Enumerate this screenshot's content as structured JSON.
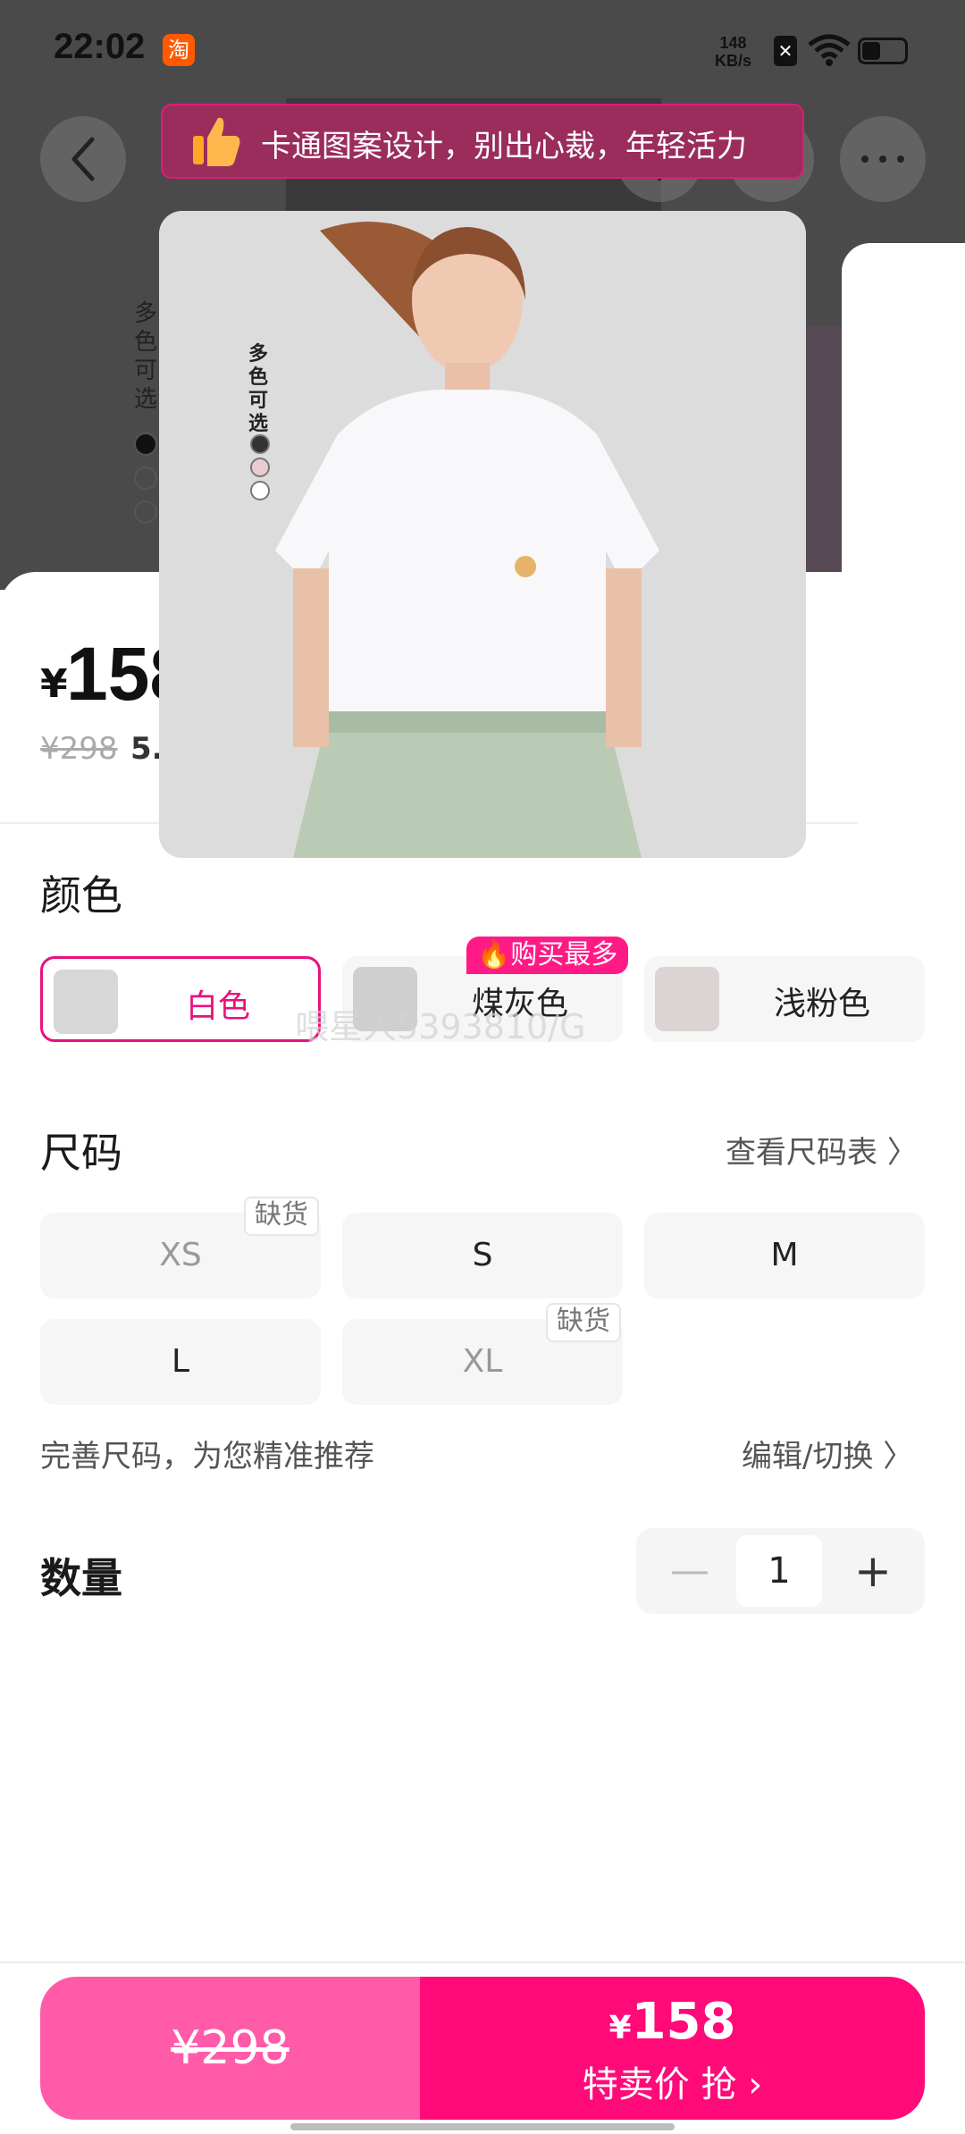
{
  "status_bar": {
    "time": "22:02",
    "app_badge": "淘",
    "net_speed_value": "148",
    "net_speed_unit": "KB/s"
  },
  "tooltip": {
    "text": "卡通图案设计，别出心裁，年轻活力"
  },
  "background_page": {
    "side_text": "多色可选"
  },
  "product_card": {
    "side_text": "多色可选"
  },
  "price": {
    "symbol": "¥",
    "value": "158",
    "original": "¥298",
    "discount": "5."
  },
  "color": {
    "title": "颜色",
    "options": [
      {
        "label": "白色",
        "selected": true
      },
      {
        "label": "煤灰色",
        "selected": false
      },
      {
        "label": "浅粉色",
        "selected": false
      }
    ],
    "hot_badge": "购买最多"
  },
  "watermark": "喂星人5393810/G",
  "size": {
    "title": "尺码",
    "chart_link": "查看尺码表",
    "options": [
      {
        "label": "XS",
        "out_of_stock": true
      },
      {
        "label": "S",
        "out_of_stock": false
      },
      {
        "label": "M",
        "out_of_stock": false
      },
      {
        "label": "L",
        "out_of_stock": false
      },
      {
        "label": "XL",
        "out_of_stock": true
      }
    ],
    "oos_label": "缺货",
    "hint": "完善尺码，为您精准推荐",
    "edit_link": "编辑/切换"
  },
  "quantity": {
    "title": "数量",
    "minus": "—",
    "value": "1",
    "plus": "+"
  },
  "bottom": {
    "original_price": "¥298",
    "flash_currency": "¥",
    "flash_price": "158",
    "flash_label": "特卖价 抢"
  },
  "colors": {
    "accent": "#ff0a78",
    "accent_light": "#ff5ba8",
    "selected_border": "#e8117d"
  }
}
